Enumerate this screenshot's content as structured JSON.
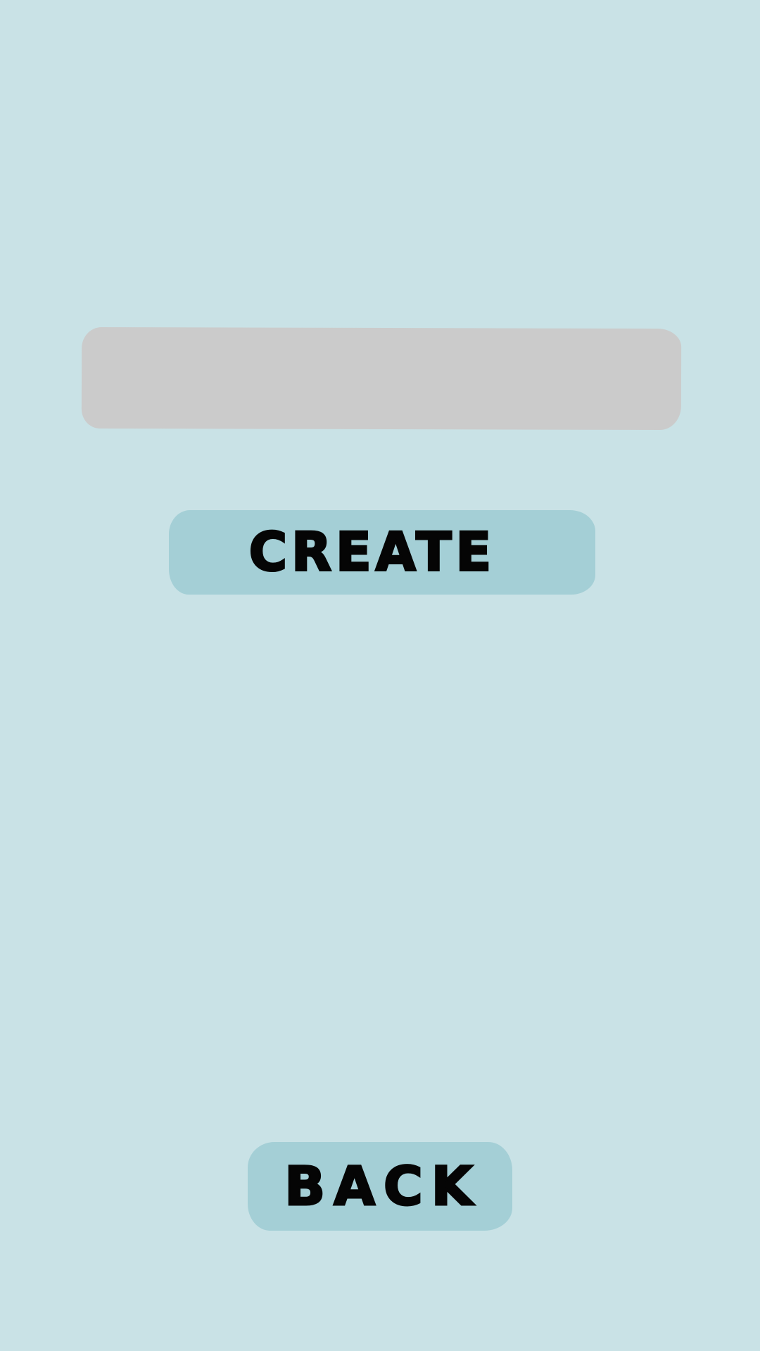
{
  "colors": {
    "background": "#c9e2e6",
    "field": "#cbcbcb",
    "button": "#a4cfd6",
    "text": "#050505"
  },
  "name_field": {
    "value": "",
    "placeholder": ""
  },
  "buttons": {
    "create_label": "CREATE",
    "back_label": "BACK"
  }
}
